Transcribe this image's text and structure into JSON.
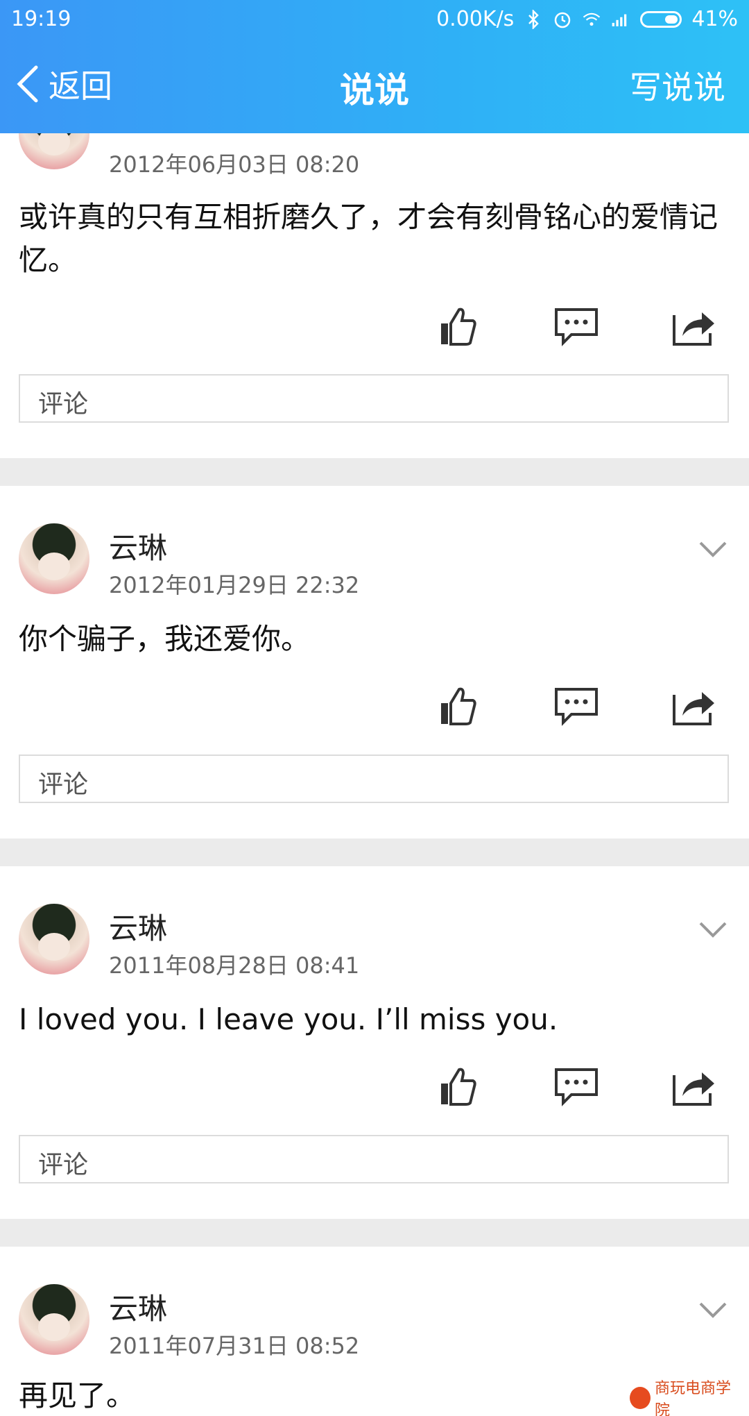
{
  "status_bar": {
    "time": "19:19",
    "network_speed": "0.00K/s",
    "battery": "41%",
    "icons": [
      "bluetooth-icon",
      "alarm-icon",
      "wifi-icon",
      "signal-icon",
      "battery-icon"
    ]
  },
  "nav": {
    "back_label": "返回",
    "title": "说说",
    "right_action": "写说说"
  },
  "posts": [
    {
      "name": "",
      "date": "2012年06月03日 08:20",
      "content": "或许真的只有互相折磨久了，才会有刻骨铭心的爱情记忆。",
      "comment_placeholder": "评论"
    },
    {
      "name": "云琳",
      "date": "2012年01月29日 22:32",
      "content": "你个骗子，我还爱你。",
      "comment_placeholder": "评论"
    },
    {
      "name": "云琳",
      "date": "2011年08月28日 08:41",
      "content": "I loved you. I leave you. I’ll miss you.",
      "comment_placeholder": "评论"
    },
    {
      "name": "云琳",
      "date": "2011年07月31日 08:52",
      "content": "再见了。",
      "comment_placeholder": ""
    }
  ],
  "watermark": {
    "text": "商玩电商学院"
  },
  "colors": {
    "header_start": "#3b97f6",
    "header_end": "#2ec1f6",
    "divider": "#ebebeb",
    "icon": "#333333"
  }
}
